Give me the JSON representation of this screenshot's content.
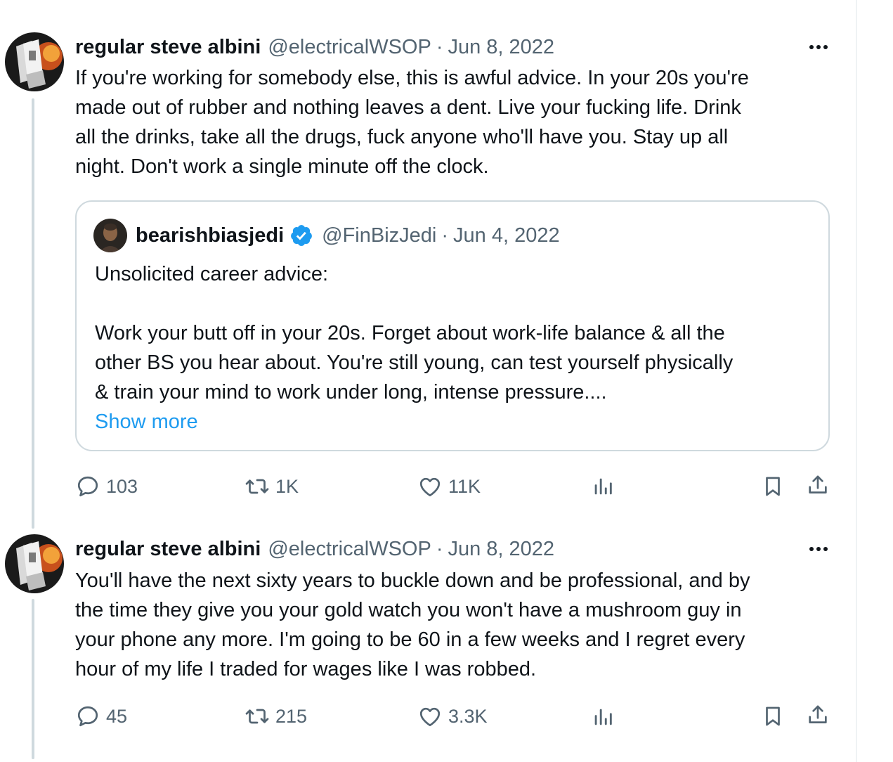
{
  "tweets": [
    {
      "name": "regular steve albini",
      "handle": "@electricalWSOP",
      "separator": "·",
      "date": "Jun 8, 2022",
      "text": "If you're working for somebody else, this is awful advice. In your 20s you're\nmade out of rubber and nothing leaves a dent. Live your fucking life. Drink\nall the drinks, take all the drugs, fuck anyone who'll have you. Stay up all\nnight. Don't work a single minute off the clock.",
      "quote": {
        "name": "bearishbiasjedi",
        "handle": "@FinBizJedi",
        "separator": "·",
        "date": "Jun 4, 2022",
        "text": "Unsolicited career advice:\n\nWork your butt off in your 20s. Forget about work-life balance & all the\nother BS you hear about. You're still young, can test yourself physically\n& train your mind to work under long, intense pressure....",
        "show_more": "Show more"
      },
      "replies": "103",
      "reposts": "1K",
      "likes": "11K"
    },
    {
      "name": "regular steve albini",
      "handle": "@electricalWSOP",
      "separator": "·",
      "date": "Jun 8, 2022",
      "text": "You'll have the next sixty years to buckle down and be professional, and by\nthe time they give you your gold watch you won't have a mushroom guy in\nyour phone any more. I'm going to be 60 in a few weeks and I regret every\nhour of my life I traded for wages like I was robbed.",
      "replies": "45",
      "reposts": "215",
      "likes": "3.3K"
    }
  ],
  "icons": {
    "reply": "speech-bubble",
    "repost": "retweet-arrows",
    "like": "heart",
    "views": "bar-chart",
    "bookmark": "bookmark",
    "share": "upload-arrow",
    "more": "three-dots",
    "verified": "blue-check-badge"
  },
  "colors": {
    "text": "#0f1419",
    "secondary": "#536471",
    "link": "#1d9bf0",
    "border": "#cfd9de"
  }
}
